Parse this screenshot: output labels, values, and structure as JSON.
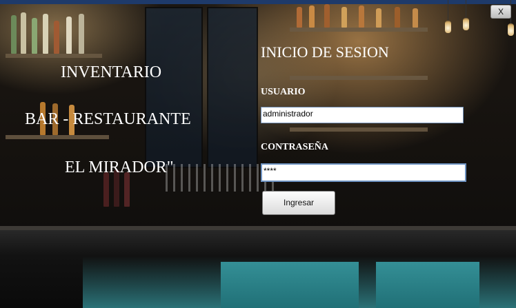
{
  "window": {
    "close_label": "X"
  },
  "branding": {
    "line1": "INVENTARIO",
    "line2": "BAR - RESTAURANTE",
    "line3": "EL MIRADOR\""
  },
  "login": {
    "title": "INICIO DE SESION",
    "user_label": "USUARIO",
    "user_value": "administrador",
    "password_label": "CONTRASEÑA",
    "password_value": "****",
    "submit_label": "Ingresar"
  },
  "colors": {
    "title_text": "#ffffff",
    "field_border": "#6d8bb3",
    "top_strip": "#1e3a6a"
  },
  "background": {
    "icon": "bar-interior-photo"
  }
}
